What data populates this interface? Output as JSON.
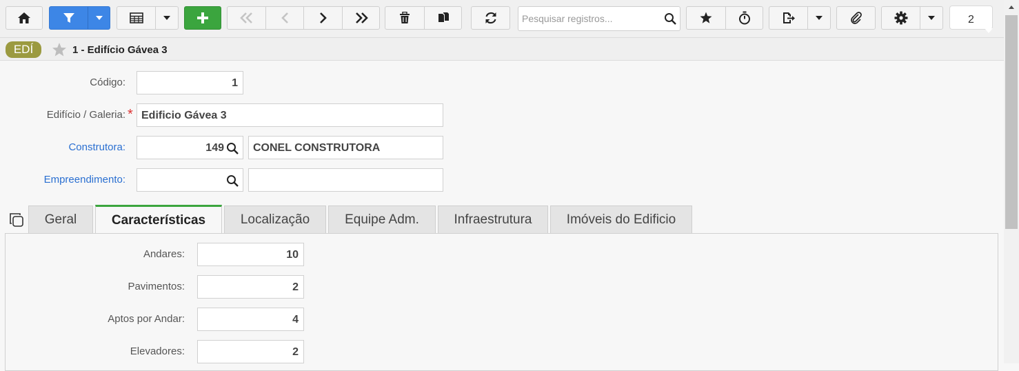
{
  "toolbar": {
    "search_placeholder": "Pesquisar registros...",
    "record_counter": "2",
    "icons": [
      "home-icon",
      "filter-icon",
      "chevron-down-icon",
      "table-icon",
      "plus-icon",
      "first-icon",
      "prev-icon",
      "next-icon",
      "last-icon",
      "trash-icon",
      "copy-icon",
      "refresh-icon",
      "search-icon",
      "star-icon",
      "timer-icon",
      "export-icon",
      "paperclip-icon",
      "gear-icon"
    ]
  },
  "record": {
    "tag": "EDÍ",
    "title": "1 - Edifício Gávea 3"
  },
  "form": {
    "codigo_label": "Código:",
    "codigo_value": "1",
    "edificio_label": "Edifício / Galeria:",
    "edificio_required": "*",
    "edificio_value": "Edificio Gávea 3",
    "construtora_label": "Construtora:",
    "construtora_code": "149",
    "construtora_name": "CONEL CONSTRUTORA",
    "empreendimento_label": "Empreendimento:",
    "empreendimento_code": "",
    "empreendimento_name": ""
  },
  "tabs": [
    "Geral",
    "Características",
    "Localização",
    "Equipe Adm.",
    "Infraestrutura",
    "Imóveis do Edificio"
  ],
  "active_tab": "Características",
  "caracteristicas": {
    "andares_label": "Andares:",
    "andares_value": "10",
    "pavimentos_label": "Pavimentos:",
    "pavimentos_value": "2",
    "aptos_label": "Aptos por Andar:",
    "aptos_value": "4",
    "elevadores_label": "Elevadores:",
    "elevadores_value": "2"
  },
  "colors": {
    "primary_blue": "#3d86e6",
    "add_green": "#3ba53e",
    "tag_olive": "#9b9a40",
    "link_blue": "#2a6fd1"
  }
}
